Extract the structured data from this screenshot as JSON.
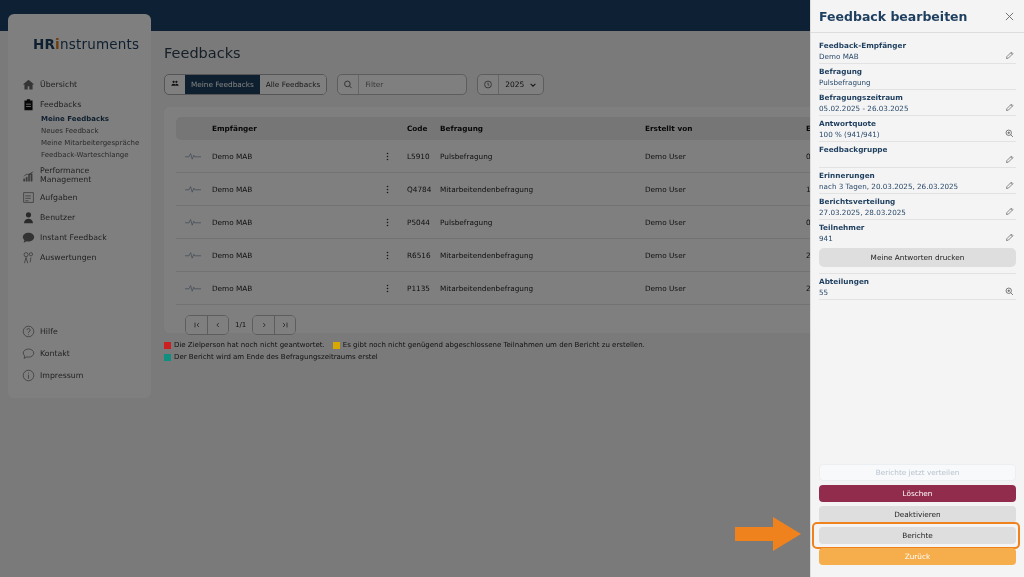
{
  "sidebar": {
    "logo": [
      "HR",
      "i",
      "nstruments"
    ],
    "items": [
      {
        "label": "Übersicht"
      },
      {
        "label": "Feedbacks",
        "children": [
          {
            "label": "Meine Feedbacks",
            "selected": true
          },
          {
            "label": "Neues Feedback",
            "selected": false
          },
          {
            "label": "Meine Mitarbeitergespräche",
            "selected": false
          },
          {
            "label": "Feedback-Warteschlange",
            "selected": false
          }
        ]
      },
      {
        "label": "Performance Management"
      },
      {
        "label": "Aufgaben"
      },
      {
        "label": "Benutzer"
      },
      {
        "label": "Instant Feedback"
      },
      {
        "label": "Auswertungen"
      }
    ],
    "footer_items": [
      {
        "label": "Hilfe"
      },
      {
        "label": "Kontakt"
      },
      {
        "label": "Impressum"
      }
    ]
  },
  "main": {
    "title": "Feedbacks",
    "toggle": [
      {
        "label": "Meine Feedbacks",
        "selected": true
      },
      {
        "label": "Alle Feedbacks",
        "selected": false
      }
    ],
    "filter": {
      "placeholder": "Filter"
    },
    "year": "2025",
    "table": {
      "columns": [
        "Empfänger",
        "Code",
        "Befragung",
        "Erstellt von",
        "E"
      ],
      "rows": [
        [
          "Demo MAB",
          "L5910",
          "Pulsbefragung",
          "Demo User",
          "0"
        ],
        [
          "Demo MAB",
          "Q4784",
          "Mitarbeitendenbefragung",
          "Demo User",
          "1"
        ],
        [
          "Demo MAB",
          "P5044",
          "Pulsbefragung",
          "Demo User",
          "0"
        ],
        [
          "Demo MAB",
          "R6516",
          "Mitarbeitendenbefragung",
          "Demo User",
          "2"
        ],
        [
          "Demo MAB",
          "P1135",
          "Mitarbeitendenbefragung",
          "Demo User",
          "2"
        ]
      ]
    },
    "pagination": "1/1",
    "legend": [
      {
        "color": "#cc1f1f",
        "text": "Die Zielperson hat noch nicht geantwortet."
      },
      {
        "color": "#d9a800",
        "text": "Es gibt noch nicht genügend abgeschlossene Teilnahmen um den Bericht zu erstellen."
      },
      {
        "color": "#0f8f80",
        "text": "Der Bericht wird am Ende des Befragungszeitraums erstel"
      }
    ]
  },
  "panel": {
    "title": "Feedback bearbeiten",
    "fields": [
      {
        "label": "Feedback-Empfänger",
        "value": "Demo MAB",
        "kind": "edit"
      },
      {
        "label": "Befragung",
        "value": "Pulsbefragung",
        "kind": "plain"
      },
      {
        "label": "Befragungszeitraum",
        "value": "05.02.2025 - 26.03.2025",
        "kind": "edit"
      },
      {
        "label": "Antwortquote",
        "value": "100 % (941/941)",
        "kind": "zoom"
      },
      {
        "label": "Feedbackgruppe",
        "kind": "edit"
      },
      {
        "label": "Erinnerungen",
        "value": "nach 3 Tagen, 20.03.2025, 26.03.2025",
        "kind": "edit"
      },
      {
        "label": "Berichtsverteilung",
        "value": "27.03.2025, 28.03.2025",
        "kind": "edit"
      },
      {
        "label": "Teilnehmer",
        "value": "941",
        "kind": "edit",
        "button": "Meine Antworten drucken"
      },
      {
        "label": "Abteilungen",
        "value": "55",
        "kind": "zoom"
      }
    ],
    "buttons": [
      {
        "label": "Berichte jetzt verteilen",
        "kind": "disabled",
        "highlighted": false
      },
      {
        "label": "Löschen",
        "kind": "danger",
        "highlighted": false
      },
      {
        "label": "Deaktivieren",
        "kind": "default",
        "highlighted": false
      },
      {
        "label": "Berichte",
        "kind": "default",
        "highlighted": true
      },
      {
        "label": "Zurück",
        "kind": "warning",
        "highlighted": false
      }
    ]
  }
}
